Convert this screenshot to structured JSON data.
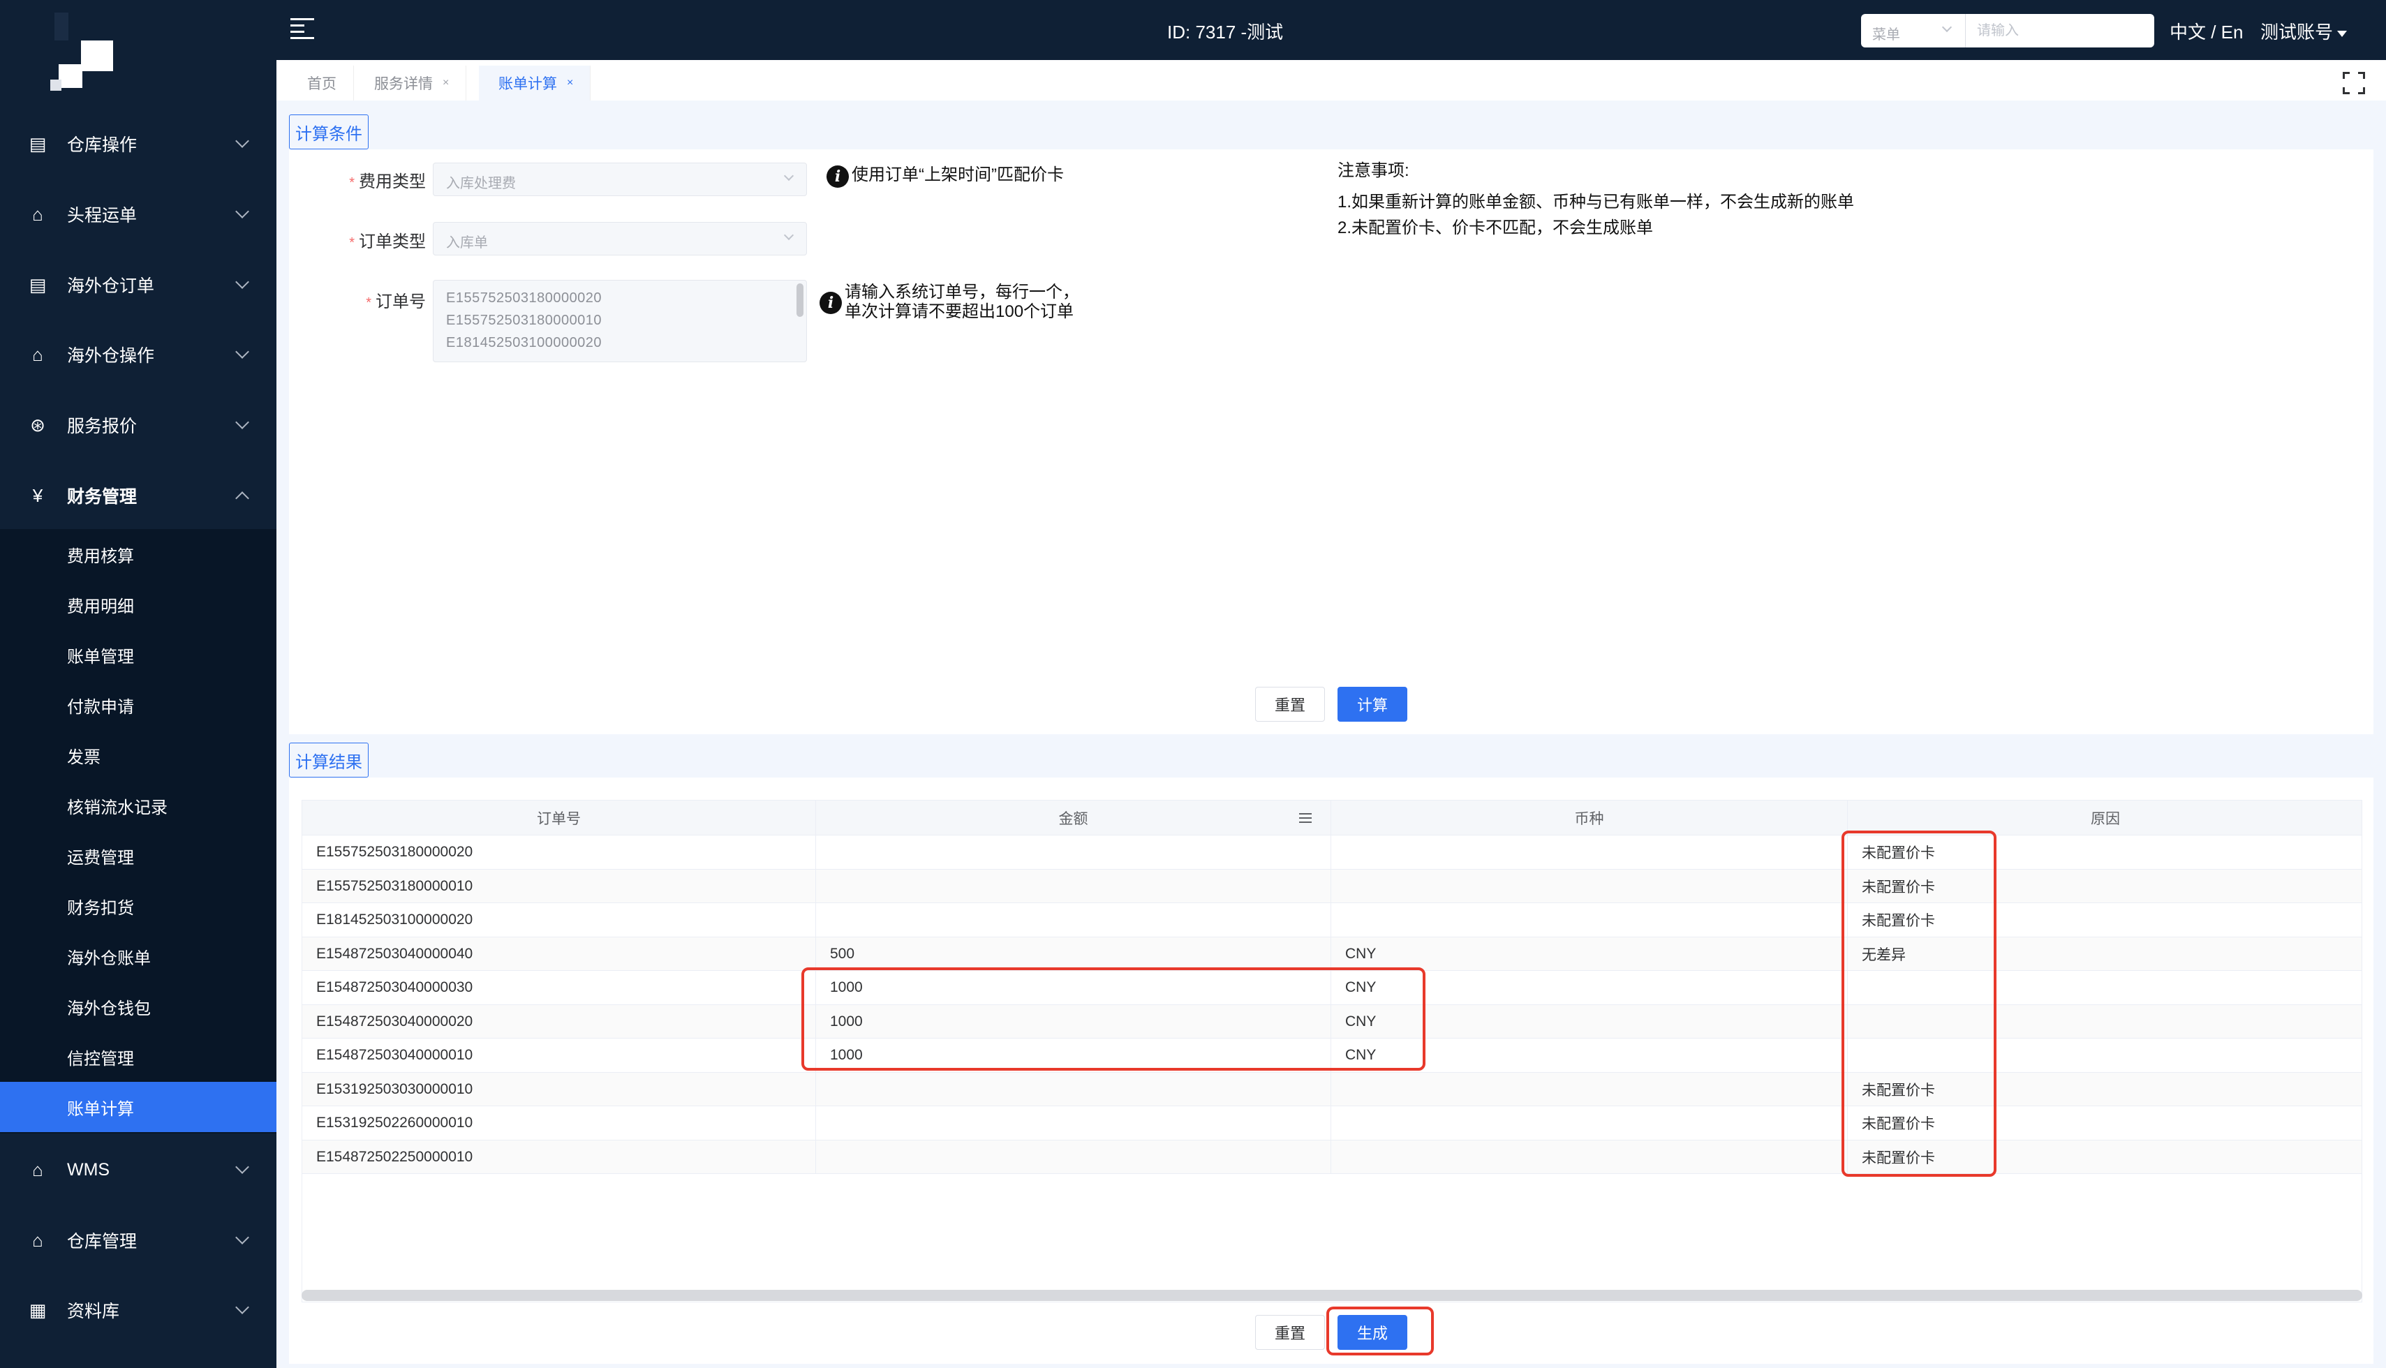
{
  "sidebar": {
    "menu": [
      {
        "label": "仓库操作",
        "icon": "warehouse-ops-icon"
      },
      {
        "label": "头程运单",
        "icon": "first-leg-icon"
      },
      {
        "label": "海外仓订单",
        "icon": "order-icon"
      },
      {
        "label": "海外仓操作",
        "icon": "overseas-ops-icon"
      },
      {
        "label": "服务报价",
        "icon": "quote-icon"
      },
      {
        "label": "财务管理",
        "icon": "finance-icon"
      },
      {
        "label": "WMS",
        "icon": "wms-icon"
      },
      {
        "label": "仓库管理",
        "icon": "warehouse-mgmt-icon"
      },
      {
        "label": "资料库",
        "icon": "database-icon"
      }
    ],
    "finance_submenu": [
      "费用核算",
      "费用明细",
      "账单管理",
      "付款申请",
      "发票",
      "核销流水记录",
      "运费管理",
      "财务扣货",
      "海外仓账单",
      "海外仓钱包",
      "信控管理",
      "账单计算"
    ],
    "active_submenu": "账单计算"
  },
  "header": {
    "title": "ID: 7317 -测试",
    "menu_select": "菜单",
    "search_placeholder": "请输入",
    "lang": "中文 / En",
    "account": "测试账号"
  },
  "tabs": [
    {
      "label": "首页",
      "closable": false
    },
    {
      "label": "服务详情",
      "closable": true
    },
    {
      "label": "账单计算",
      "closable": true,
      "active": true
    }
  ],
  "tab_close_glyph": "×",
  "conditions": {
    "section_title": "计算条件",
    "fee_type_label": "费用类型",
    "fee_type_value": "入库处理费",
    "order_type_label": "订单类型",
    "order_type_value": "入库单",
    "order_no_label": "订单号",
    "order_no_lines": [
      "E155752503180000020",
      "E155752503180000010",
      "E181452503100000020"
    ],
    "fee_type_hint": "使用订单“上架时间”匹配价卡",
    "order_no_hint_1": "请输入系统订单号，每行一个，",
    "order_no_hint_2": "单次计算请不要超出100个订单",
    "notes_title": "注意事项:",
    "notes_1": "1.如果重新计算的账单金额、币种与已有账单一样，不会生成新的账单",
    "notes_2": "2.未配置价卡、价卡不匹配，不会生成账单",
    "reset_label": "重置",
    "calc_label": "计算"
  },
  "results": {
    "section_title": "计算结果",
    "columns": [
      "订单号",
      "金额",
      "币种",
      "原因"
    ],
    "rows": [
      {
        "order": "E155752503180000020",
        "amount": "",
        "currency": "",
        "reason": "未配置价卡"
      },
      {
        "order": "E155752503180000010",
        "amount": "",
        "currency": "",
        "reason": "未配置价卡"
      },
      {
        "order": "E181452503100000020",
        "amount": "",
        "currency": "",
        "reason": "未配置价卡"
      },
      {
        "order": "E154872503040000040",
        "amount": "500",
        "currency": "CNY",
        "reason": "无差异"
      },
      {
        "order": "E154872503040000030",
        "amount": "1000",
        "currency": "CNY",
        "reason": ""
      },
      {
        "order": "E154872503040000020",
        "amount": "1000",
        "currency": "CNY",
        "reason": ""
      },
      {
        "order": "E154872503040000010",
        "amount": "1000",
        "currency": "CNY",
        "reason": ""
      },
      {
        "order": "E153192503030000010",
        "amount": "",
        "currency": "",
        "reason": "未配置价卡"
      },
      {
        "order": "E153192502260000010",
        "amount": "",
        "currency": "",
        "reason": "未配置价卡"
      },
      {
        "order": "E154872502250000010",
        "amount": "",
        "currency": "",
        "reason": "未配置价卡"
      }
    ],
    "reset_label": "重置",
    "generate_label": "生成"
  },
  "colors": {
    "sidebar_bg": "#0f2035",
    "accent": "#2e71f1",
    "highlight": "#e8392b"
  }
}
